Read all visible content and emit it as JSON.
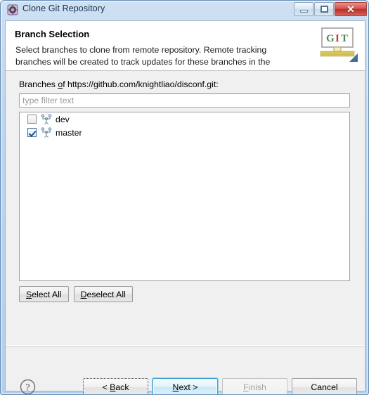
{
  "window": {
    "title": "Clone Git Repository",
    "icon": "git-repo-icon",
    "controls": {
      "minimize_label": "Minimize",
      "maximize_label": "Maximize",
      "close_label": "✕"
    }
  },
  "header": {
    "title": "Branch Selection",
    "description": "Select branches to clone from remote repository. Remote tracking branches will be created to track updates for these branches in the",
    "logo": {
      "name": "git-wizard-logo",
      "letters": [
        "G",
        "I",
        "T"
      ],
      "colors": {
        "g": "#4f8a4f",
        "i": "#b23b3b",
        "t": "#4f8a4f",
        "bar": "#c9b23f"
      }
    }
  },
  "body": {
    "branches_label_prefix": "Branches ",
    "branches_label_mnemonic": "o",
    "branches_label_suffix": "f https://github.com/knightliao/disconf.git:",
    "filter": {
      "placeholder": "type filter text",
      "value": ""
    },
    "branches": [
      {
        "name": "dev",
        "checked": false,
        "icon": "branch-icon"
      },
      {
        "name": "master",
        "checked": true,
        "icon": "branch-icon"
      }
    ],
    "select_all": {
      "mnemonic": "S",
      "rest": "elect All"
    },
    "deselect_all": {
      "mnemonic": "D",
      "rest": "eselect All"
    }
  },
  "footer": {
    "help_icon": "help-question-icon",
    "buttons": [
      {
        "name": "back-button",
        "prefix": "< ",
        "mnemonic": "B",
        "suffix": "ack",
        "state": "focused"
      },
      {
        "name": "next-button",
        "prefix": "",
        "mnemonic": "N",
        "suffix": "ext >",
        "state": "default"
      },
      {
        "name": "finish-button",
        "prefix": "",
        "mnemonic": "F",
        "suffix": "inish",
        "state": "disabled"
      },
      {
        "name": "cancel-button",
        "prefix": "",
        "mnemonic": "",
        "suffix": "Cancel",
        "state": "normal"
      }
    ]
  }
}
